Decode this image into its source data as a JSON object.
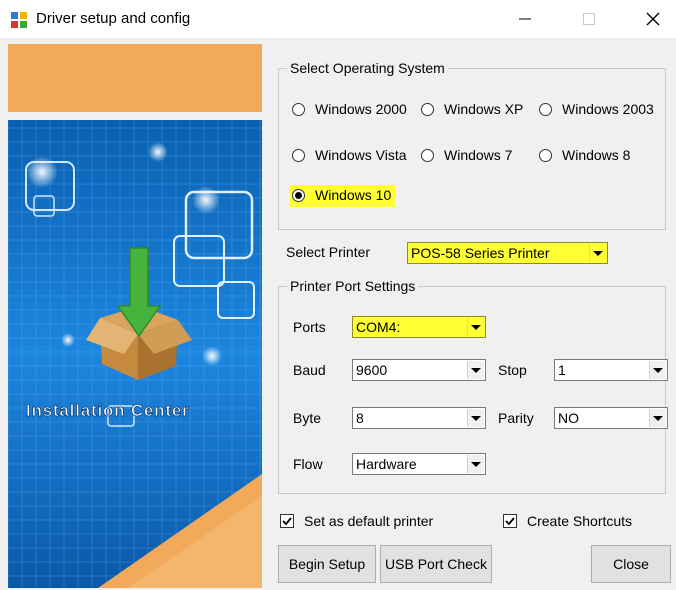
{
  "window": {
    "title": "Driver setup and config",
    "icon": "installer-icon",
    "controls": [
      "minimize-icon",
      "maximize-icon",
      "close-icon"
    ]
  },
  "banner": {
    "caption": "Installation Center",
    "icon": "box-download-icon"
  },
  "os_group": {
    "legend": "Select Operating System",
    "options": [
      {
        "label": "Windows 2000",
        "selected": false
      },
      {
        "label": "Windows XP",
        "selected": false
      },
      {
        "label": "Windows 2003",
        "selected": false
      },
      {
        "label": "Windows Vista",
        "selected": false
      },
      {
        "label": "Windows 7",
        "selected": false
      },
      {
        "label": "Windows 8",
        "selected": false
      },
      {
        "label": "Windows 10",
        "selected": true
      }
    ]
  },
  "printer": {
    "label": "Select Printer",
    "value": "POS-58 Series Printer"
  },
  "port_group": {
    "legend": "Printer Port Settings",
    "ports": {
      "label": "Ports",
      "value": "COM4:"
    },
    "baud": {
      "label": "Baud",
      "value": "9600"
    },
    "stop": {
      "label": "Stop",
      "value": "1"
    },
    "byte": {
      "label": "Byte",
      "value": "8"
    },
    "parity": {
      "label": "Parity",
      "value": "NO"
    },
    "flow": {
      "label": "Flow",
      "value": "Hardware"
    }
  },
  "options": {
    "default_printer": {
      "label": "Set as default printer",
      "checked": true
    },
    "shortcuts": {
      "label": "Create Shortcuts",
      "checked": true
    }
  },
  "buttons": {
    "begin_setup": "Begin Setup",
    "usb_check": "USB Port Check",
    "close": "Close"
  },
  "colors": {
    "highlight": "#ffff33",
    "banner_orange": "#f2a95a",
    "banner_blue": "#1a73c8"
  }
}
